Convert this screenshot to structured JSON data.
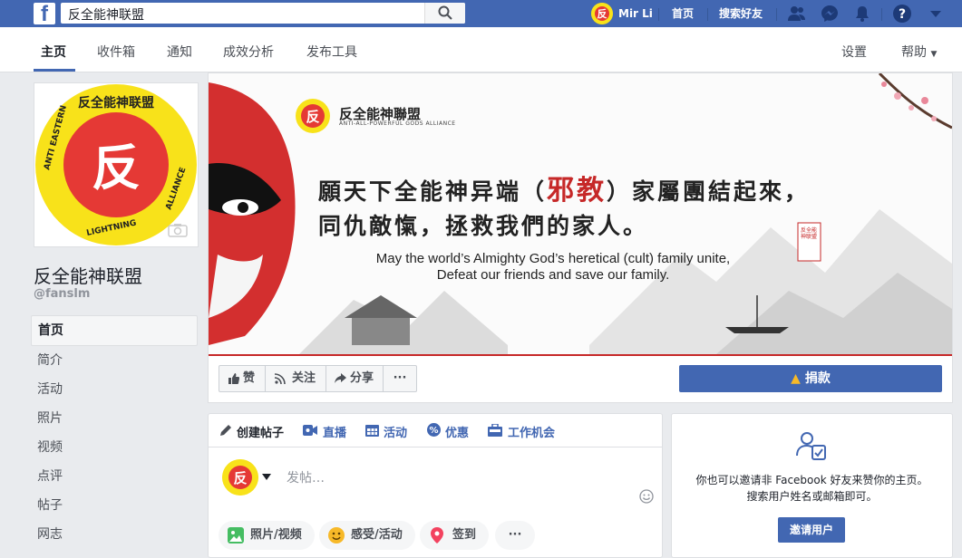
{
  "topbar": {
    "logo": "f",
    "search_value": "反全能神联盟",
    "user_name": "Mir Li",
    "home": "首页",
    "find_friends": "搜索好友"
  },
  "page_nav": {
    "items": [
      "主页",
      "收件箱",
      "通知",
      "成效分析",
      "发布工具"
    ],
    "settings": "设置",
    "help": "帮助"
  },
  "profile": {
    "logo_top": "反全能神联盟",
    "logo_ring": "ANTI EASTERN LIGHTNING ALLIANCE",
    "logo_char": "反",
    "name": "反全能神联盟",
    "handle": "@fanslm"
  },
  "sidebar": {
    "items": [
      "首页",
      "简介",
      "活动",
      "照片",
      "视频",
      "点评",
      "帖子",
      "网志"
    ]
  },
  "cover": {
    "logo_title": "反全能神聯盟",
    "logo_sub": "ANTI-ALL-POWERFUL GODS ALLIANCE",
    "line1_a": "願天下全能神异端（",
    "line1_red": "邪教",
    "line1_b": "）家屬團結起來，",
    "line2": "同仇敵愾，拯救我們的家人。",
    "en1": "May the world’s Almighty God’s heretical (cult) family unite,",
    "en2": "Defeat our friends and save our family.",
    "seal": "反全能神联盟"
  },
  "actions": {
    "like": "赞",
    "follow": "关注",
    "share": "分享",
    "more": "···",
    "donate": "捐款"
  },
  "composer": {
    "tabs": [
      "创建帖子",
      "直播",
      "活动",
      "优惠",
      "工作机会"
    ],
    "placeholder": "发帖…",
    "buttons": [
      "照片/视频",
      "感受/活动",
      "签到"
    ],
    "more": "···"
  },
  "invite": {
    "text1": "你也可以邀请非 Facebook 好友来赞你的主页。",
    "text2": "搜索用户姓名或邮箱即可。",
    "button": "邀请用户"
  },
  "colors": {
    "brand": "#4267b2",
    "logo_yellow": "#f8e21a",
    "logo_red": "#e53935",
    "cover_red": "#c62828"
  }
}
